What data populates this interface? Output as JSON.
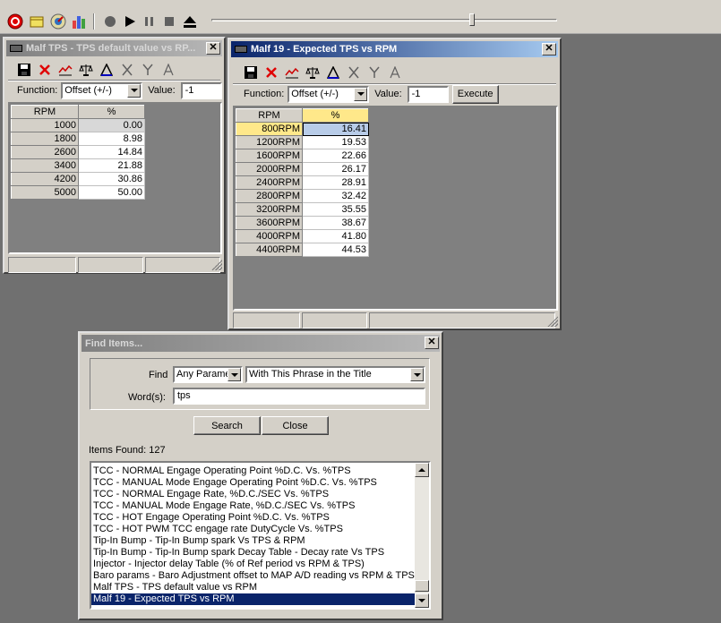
{
  "malf_tps": {
    "title": "Malf TPS - TPS default value vs RP...",
    "function_label": "Function:",
    "function_value": "Offset (+/-)",
    "value_label": "Value:",
    "value": "-1",
    "columns": [
      "RPM",
      "%"
    ],
    "rows": [
      {
        "rpm": "1000",
        "pct": "0.00"
      },
      {
        "rpm": "1800",
        "pct": "8.98"
      },
      {
        "rpm": "2600",
        "pct": "14.84"
      },
      {
        "rpm": "3400",
        "pct": "21.88"
      },
      {
        "rpm": "4200",
        "pct": "30.86"
      },
      {
        "rpm": "5000",
        "pct": "50.00"
      }
    ]
  },
  "malf19": {
    "title": "Malf 19 - Expected TPS vs RPM",
    "function_label": "Function:",
    "function_value": "Offset (+/-)",
    "value_label": "Value:",
    "value": "-1",
    "execute_label": "Execute",
    "columns": [
      "RPM",
      "%"
    ],
    "rows": [
      {
        "rpm": "800RPM",
        "pct": "16.41"
      },
      {
        "rpm": "1200RPM",
        "pct": "19.53"
      },
      {
        "rpm": "1600RPM",
        "pct": "22.66"
      },
      {
        "rpm": "2000RPM",
        "pct": "26.17"
      },
      {
        "rpm": "2400RPM",
        "pct": "28.91"
      },
      {
        "rpm": "2800RPM",
        "pct": "32.42"
      },
      {
        "rpm": "3200RPM",
        "pct": "35.55"
      },
      {
        "rpm": "3600RPM",
        "pct": "38.67"
      },
      {
        "rpm": "4000RPM",
        "pct": "41.80"
      },
      {
        "rpm": "4400RPM",
        "pct": "44.53"
      }
    ]
  },
  "find": {
    "title": "Find Items...",
    "find_label": "Find",
    "param_value": "Any Parame",
    "mode_value": "With This Phrase in the Title",
    "words_label": "Word(s):",
    "words_value": "tps",
    "search_label": "Search",
    "close_label": "Close",
    "items_found_label": "Items Found: 127",
    "items": [
      "TCC - NORMAL Engage Operating Point %D.C. Vs. %TPS",
      "TCC - MANUAL Mode Engage Operating Point %D.C. Vs. %TPS",
      "TCC - NORMAL Engage Rate,  %D.C./SEC Vs. %TPS",
      "TCC - MANUAL Mode Engage Rate,  %D.C./SEC Vs. %TPS",
      "TCC - HOT Engage Operating Point %D.C. Vs. %TPS",
      "TCC - HOT PWM TCC engage rate DutyCycle Vs. %TPS",
      "Tip-In Bump - Tip-In Bump spark Vs TPS & RPM",
      "Tip-In Bump - Tip-In Bump spark Decay Table - Decay rate Vs TPS",
      "Injector - Injector delay Table (% of Ref period vs RPM & TPS)",
      "Baro params - Baro Adjustment offset to MAP A/D reading vs RPM & TPS",
      "Malf TPS - TPS default value vs RPM",
      "Malf 19 - Expected TPS vs RPM"
    ],
    "selected_index": 11
  },
  "colors": {
    "desktop": "#707070",
    "active_title": "#0a246a",
    "header_highlight": "#ffe88a",
    "selected_cell": "#b8cce8"
  }
}
